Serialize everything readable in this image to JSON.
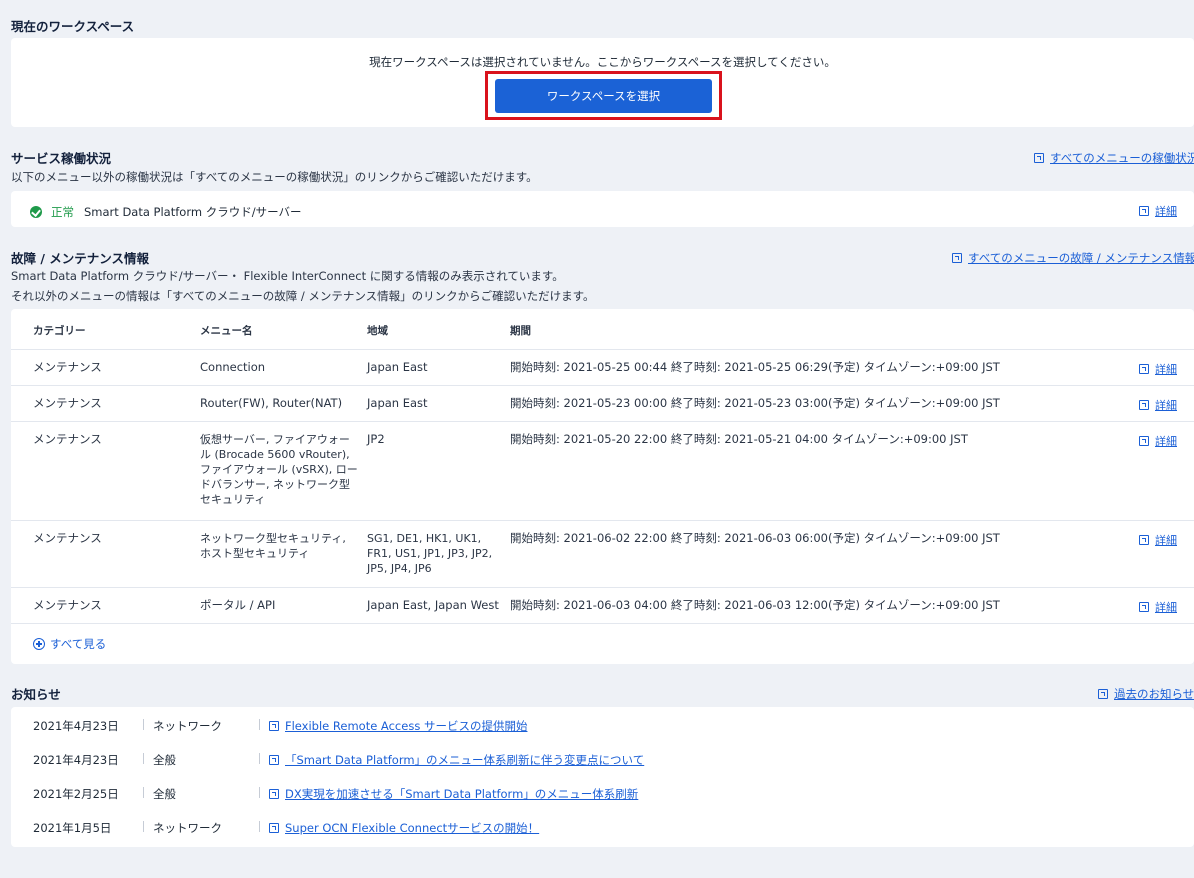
{
  "workspace": {
    "title": "現在のワークスペース",
    "message": "現在ワークスペースは選択されていません。ここからワークスペースを選択してください。",
    "button": "ワークスペースを選択"
  },
  "service": {
    "title": "サービス稼働状況",
    "description": "以下のメニュー以外の稼働状況は「すべてのメニューの稼働状況」のリンクからご確認いただけます。",
    "all_link": "すべてのメニューの稼働状況",
    "status_label": "正常",
    "status_name": "Smart Data Platform クラウド/サーバー",
    "detail_link": "詳細"
  },
  "maintenance": {
    "title": "故障 / メンテナンス情報",
    "all_link": "すべてのメニューの故障 / メンテナンス情報",
    "description1": "Smart Data Platform クラウド/サーバー・ Flexible InterConnect に関する情報のみ表示されています。",
    "description2": "それ以外のメニューの情報は「すべてのメニューの故障 / メンテナンス情報」のリンクからご確認いただけます。",
    "columns": [
      "カテゴリー",
      "メニュー名",
      "地域",
      "期間"
    ],
    "rows": [
      {
        "category": "メンテナンス",
        "menu": "Connection",
        "region": "Japan East",
        "period": "開始時刻: 2021-05-25 00:44 終了時刻: 2021-05-25 06:29(予定) タイムゾーン:+09:00 JST",
        "detail": "詳細"
      },
      {
        "category": "メンテナンス",
        "menu": "Router(FW), Router(NAT)",
        "region": "Japan East",
        "period": "開始時刻: 2021-05-23 00:00 終了時刻: 2021-05-23 03:00(予定) タイムゾーン:+09:00 JST",
        "detail": "詳細"
      },
      {
        "category": "メンテナンス",
        "menu": "仮想サーバー, ファイアウォール (Brocade 5600 vRouter), ファイアウォール (vSRX), ロードバランサー, ネットワーク型セキュリティ",
        "region": "JP2",
        "period": "開始時刻: 2021-05-20 22:00 終了時刻: 2021-05-21 04:00 タイムゾーン:+09:00 JST",
        "detail": "詳細"
      },
      {
        "category": "メンテナンス",
        "menu": "ネットワーク型セキュリティ, ホスト型セキュリティ",
        "region": "SG1, DE1, HK1, UK1, FR1, US1, JP1, JP3, JP2, JP5, JP4, JP6",
        "period": "開始時刻: 2021-06-02 22:00 終了時刻: 2021-06-03 06:00(予定) タイムゾーン:+09:00 JST",
        "detail": "詳細"
      },
      {
        "category": "メンテナンス",
        "menu": "ポータル / API",
        "region": "Japan East, Japan West",
        "period": "開始時刻: 2021-06-03 04:00 終了時刻: 2021-06-03 12:00(予定) タイムゾーン:+09:00 JST",
        "detail": "詳細"
      }
    ],
    "see_all": "すべて見る"
  },
  "news": {
    "title": "お知らせ",
    "past_link": "過去のお知らせ",
    "items": [
      {
        "date": "2021年4月23日",
        "category": "ネットワーク",
        "title": "Flexible Remote Access サービスの提供開始"
      },
      {
        "date": "2021年4月23日",
        "category": "全般",
        "title": "「Smart Data Platform」のメニュー体系刷新に伴う変更点について"
      },
      {
        "date": "2021年2月25日",
        "category": "全般",
        "title": "DX実現を加速させる「Smart Data Platform」のメニュー体系刷新"
      },
      {
        "date": "2021年1月5日",
        "category": "ネットワーク",
        "title": "Super OCN Flexible Connectサービスの開始！"
      }
    ]
  }
}
